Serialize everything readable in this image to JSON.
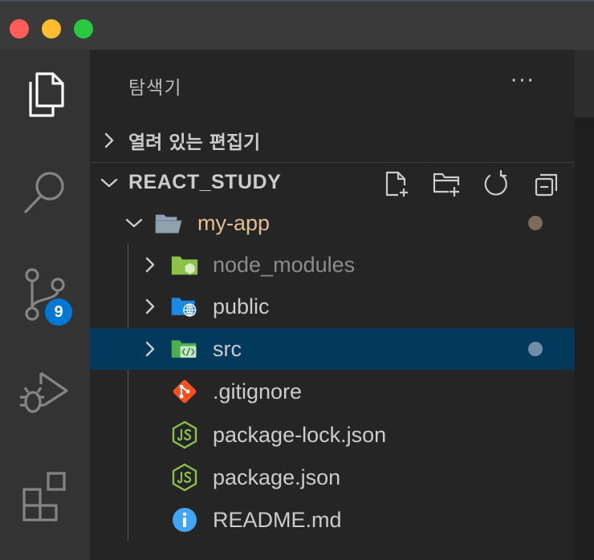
{
  "window": {
    "controls": [
      "close",
      "minimize",
      "maximize"
    ]
  },
  "activity_bar": {
    "items": [
      {
        "name": "explorer",
        "icon": "files-icon",
        "active": true
      },
      {
        "name": "search",
        "icon": "search-icon"
      },
      {
        "name": "source-control",
        "icon": "source-control-icon",
        "badge": "9"
      },
      {
        "name": "run-debug",
        "icon": "run-debug-icon"
      },
      {
        "name": "extensions",
        "icon": "extensions-icon"
      }
    ]
  },
  "sidebar": {
    "title": "탐색기",
    "more_label": "···",
    "open_editors_label": "열려 있는 편집기",
    "root_label": "REACT_STUDY",
    "root_actions": [
      "new-file-icon",
      "new-folder-icon",
      "refresh-icon",
      "collapse-all-icon"
    ],
    "tree": [
      {
        "name": "my-app",
        "type": "folder",
        "expanded": true,
        "color": "#e2c08d",
        "decoration": "#7d6c57"
      },
      {
        "name": "node_modules",
        "type": "folder",
        "color": "#8c8c8c",
        "icon": "node-folder-icon"
      },
      {
        "name": "public",
        "type": "folder",
        "color": "#cccccc",
        "icon": "public-folder-icon"
      },
      {
        "name": "src",
        "type": "folder",
        "color": "#cccccc",
        "icon": "src-folder-icon",
        "selected": true,
        "decoration": "#6f8fa8"
      },
      {
        "name": ".gitignore",
        "type": "file",
        "color": "#cccccc",
        "icon": "git-icon"
      },
      {
        "name": "package-lock.json",
        "type": "file",
        "color": "#cccccc",
        "icon": "nodejs-icon"
      },
      {
        "name": "package.json",
        "type": "file",
        "color": "#cccccc",
        "icon": "nodejs-icon"
      },
      {
        "name": "README.md",
        "type": "file",
        "color": "#cccccc",
        "icon": "info-icon"
      }
    ]
  },
  "colors": {
    "selection": "#04395e",
    "badge": "#0078d4",
    "modified_folder": "#e2c08d"
  }
}
